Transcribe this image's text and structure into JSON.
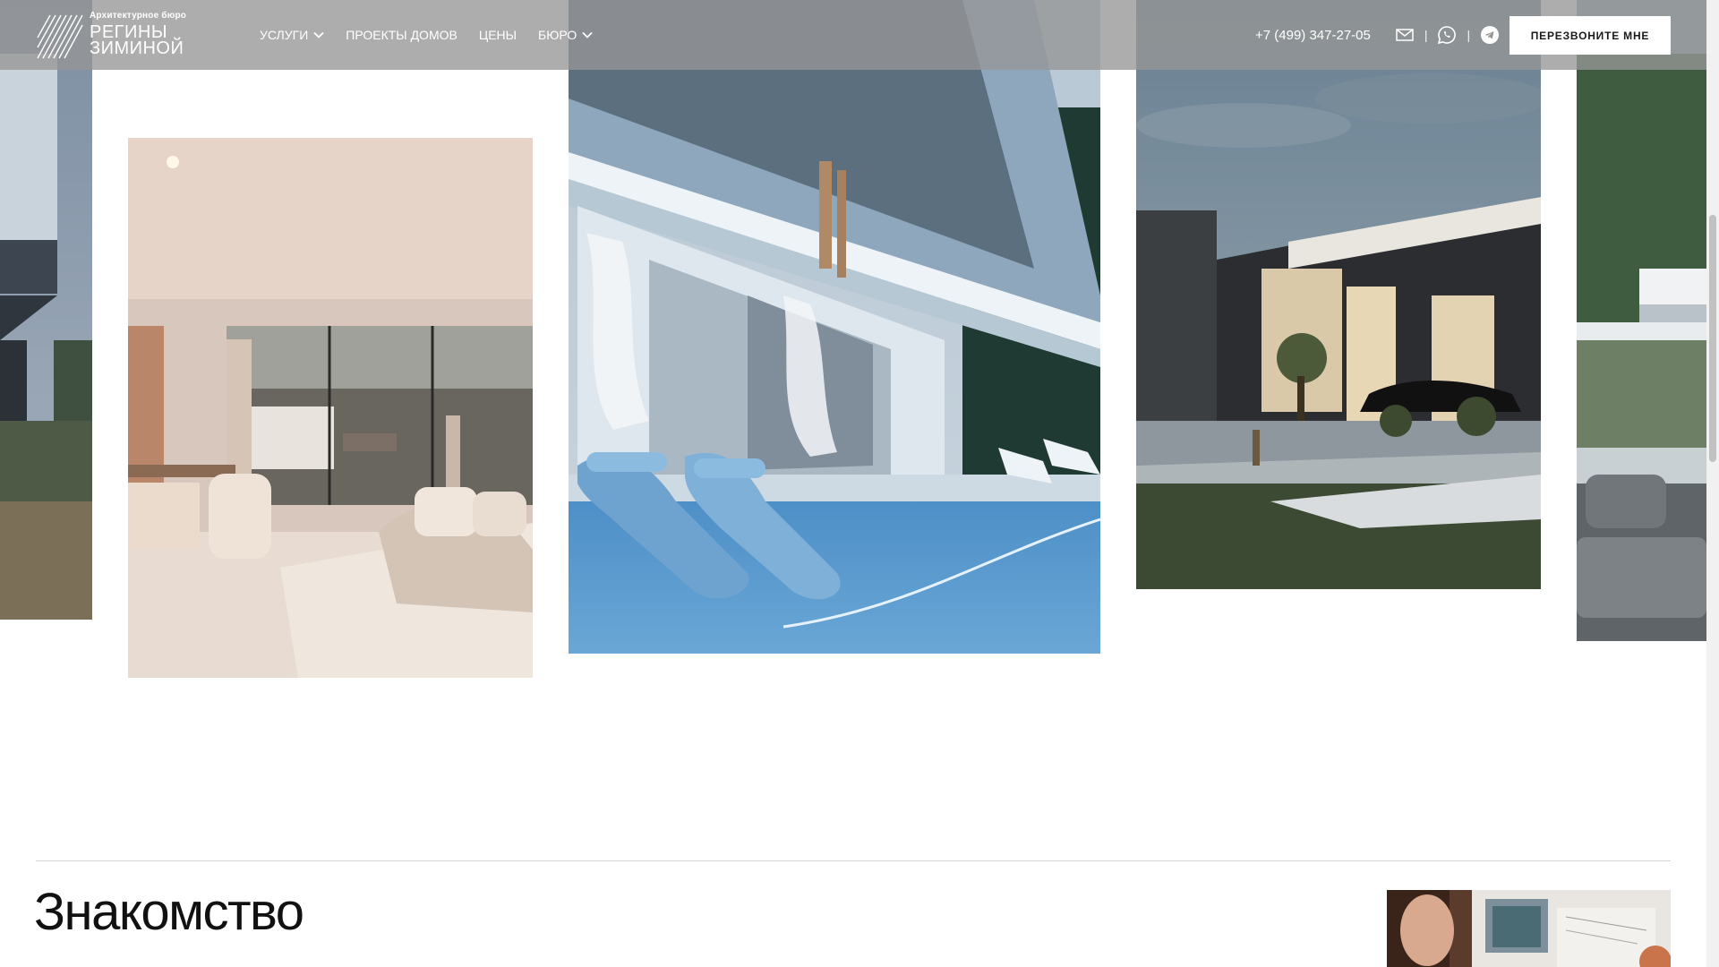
{
  "header": {
    "logo": {
      "subtitle": "Архитектурное бюро",
      "name_line1": "РЕГИНЫ",
      "name_line2": "ЗИМИНОЙ"
    },
    "nav": [
      {
        "label": "УСЛУГИ",
        "has_dropdown": true
      },
      {
        "label": "ПРОЕКТЫ ДОМОВ",
        "has_dropdown": false
      },
      {
        "label": "ЦЕНЫ",
        "has_dropdown": false
      },
      {
        "label": "БЮРО",
        "has_dropdown": true
      }
    ],
    "phone": "+7 (499) 347-27-05",
    "separator": "|",
    "contact_icons": [
      "mail-icon",
      "whatsapp-icon",
      "telegram-icon"
    ],
    "callback_label": "ПЕРЕЗВОНИТЕ МНЕ"
  },
  "gallery": {
    "photos": [
      "exterior-left-photo",
      "interior-living-room-photo",
      "pool-villa-photo",
      "garage-night-photo",
      "exterior-right-photo"
    ]
  },
  "section": {
    "title": "Знакомство"
  },
  "colors": {
    "header_bg": "#969696",
    "text_light": "#ffffff",
    "button_bg": "#ffffff",
    "title": "#111111"
  }
}
